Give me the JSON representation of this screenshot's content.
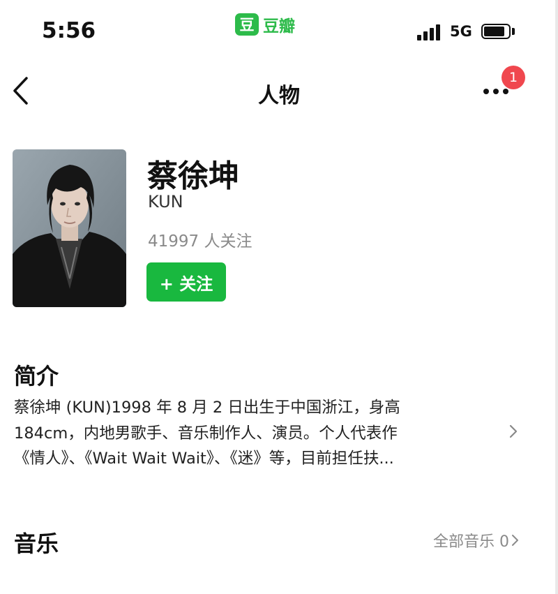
{
  "status_bar": {
    "time": "5:56",
    "app_logo": "豆",
    "app_name": "豆瓣",
    "network": "5G",
    "signal_icon": "signal-bars-icon",
    "battery_icon": "battery-icon"
  },
  "nav": {
    "title": "人物",
    "back_icon": "chevron-left-icon",
    "more_icon": "more-dots-icon",
    "notification_count": "1"
  },
  "profile": {
    "name": "蔡徐坤",
    "alias": "KUN",
    "followers": "41997 人关注",
    "follow_button": "+ 关注"
  },
  "intro": {
    "title": "简介",
    "lines": [
      "蔡徐坤 (KUN)1998 年 8 月 2 日出生于中国浙江，身高",
      "184cm，内地男歌手、音乐制作人、演员。个人代表作",
      "《情人》、《Wait Wait Wait》、《迷》等，目前担任扶..."
    ]
  },
  "music": {
    "title": "音乐",
    "link_label": "全部音乐 0"
  },
  "colors": {
    "accent_green": "#19b83f",
    "badge_red": "#f0474e",
    "muted_text": "#8a8a8a"
  }
}
